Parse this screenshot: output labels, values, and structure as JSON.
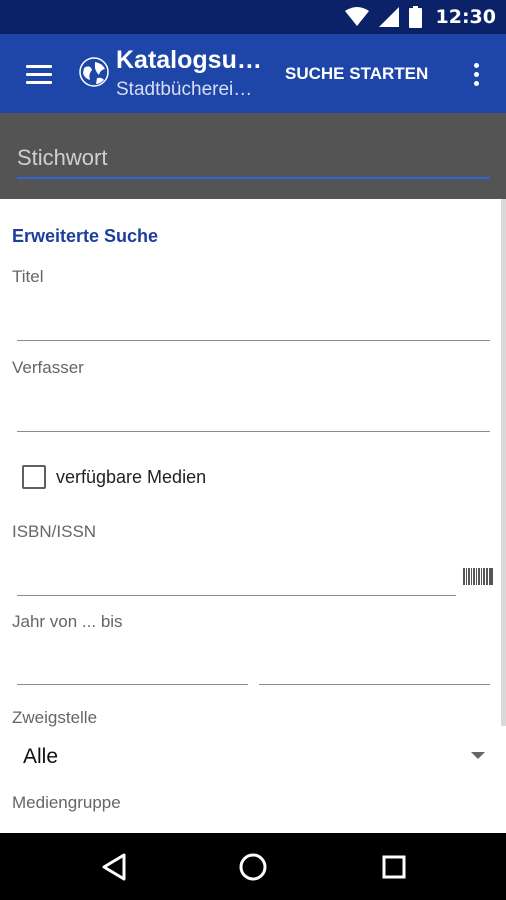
{
  "status_bar": {
    "time": "12:30",
    "icons": [
      "wifi-icon",
      "cell-signal-icon",
      "battery-icon"
    ]
  },
  "app_bar": {
    "menu_icon": "hamburger-menu-icon",
    "logo_icon": "globe-logo-icon",
    "title": "Katalogsu…",
    "subtitle": "Stadtbücherei…",
    "action_label": "SUCHE STARTEN",
    "overflow_icon": "more-vertical-icon"
  },
  "search": {
    "keyword_placeholder": "Stichwort"
  },
  "advanced": {
    "section_title": "Erweiterte Suche",
    "title_label": "Titel",
    "author_label": "Verfasser",
    "available_label": "verfügbare Medien",
    "available_checked": false,
    "isbn_label": "ISBN/ISSN",
    "barcode_icon": "barcode-scanner-icon",
    "year_label": "Jahr von ... bis",
    "branch_label": "Zweigstelle",
    "branch_value": "Alle",
    "media_group_label": "Mediengruppe"
  },
  "nav_bar": {
    "back_icon": "back-icon",
    "home_icon": "home-icon",
    "recents_icon": "recents-icon"
  },
  "colors": {
    "status_bar": "#0b2269",
    "app_bar": "#1d46a8",
    "search_area": "#545454",
    "accent": "#2f63d6",
    "section_title": "#1c3f9c"
  }
}
